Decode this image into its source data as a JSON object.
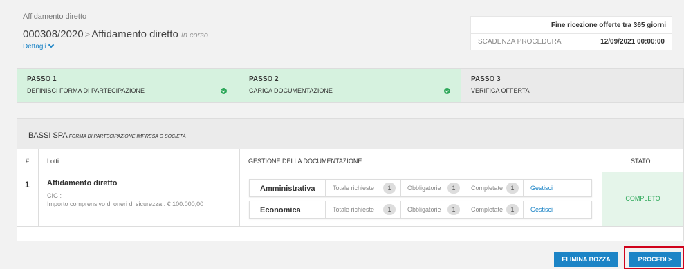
{
  "header": {
    "breadcrumb": "Affidamento diretto",
    "code": "000308/2020",
    "separator": ">",
    "procedure_name": "Affidamento diretto",
    "status": "In corso",
    "details_label": "Dettagli"
  },
  "deadline": {
    "headline": "Fine ricezione offerte tra 365 giorni",
    "label": "SCADENZA PROCEDURA",
    "value": "12/09/2021 00:00:00"
  },
  "steps": [
    {
      "number": "PASSO 1",
      "name": "DEFINISCI FORMA DI PARTECIPAZIONE",
      "state": "done"
    },
    {
      "number": "PASSO 2",
      "name": "CARICA DOCUMENTAZIONE",
      "state": "done"
    },
    {
      "number": "PASSO 3",
      "name": "VERIFICA OFFERTA",
      "state": "todo"
    }
  ],
  "company": {
    "name": "BASSI SPA",
    "form": "FORMA DI PARTECIPAZIONE IMPRESA O SOCIETÀ"
  },
  "table": {
    "headers": {
      "num": "#",
      "lots": "Lotti",
      "docs": "GESTIONE DELLA DOCUMENTAZIONE",
      "state": "STATO"
    },
    "row": {
      "num": "1",
      "title": "Affidamento diretto",
      "cig": "CIG :",
      "note": "Importo comprensivo di oneri di sicurezza : € 100.000,00",
      "state": "COMPLETO"
    },
    "docs": [
      {
        "name": "Amministrativa",
        "total_label": "Totale richieste",
        "total": "1",
        "mandatory_label": "Obbligatorie",
        "mandatory": "1",
        "completed_label": "Completate",
        "completed": "1",
        "manage": "Gestisci"
      },
      {
        "name": "Economica",
        "total_label": "Totale richieste",
        "total": "1",
        "mandatory_label": "Obbligatorie",
        "mandatory": "1",
        "completed_label": "Completate",
        "completed": "1",
        "manage": "Gestisci"
      }
    ]
  },
  "actions": {
    "delete_label": "ELIMINA BOZZA",
    "proceed_label": "PROCEDI >"
  },
  "colors": {
    "accent": "#1c84c6",
    "done_step": "#d6f2df",
    "success": "#2ea85a",
    "highlight": "#d0021b"
  }
}
